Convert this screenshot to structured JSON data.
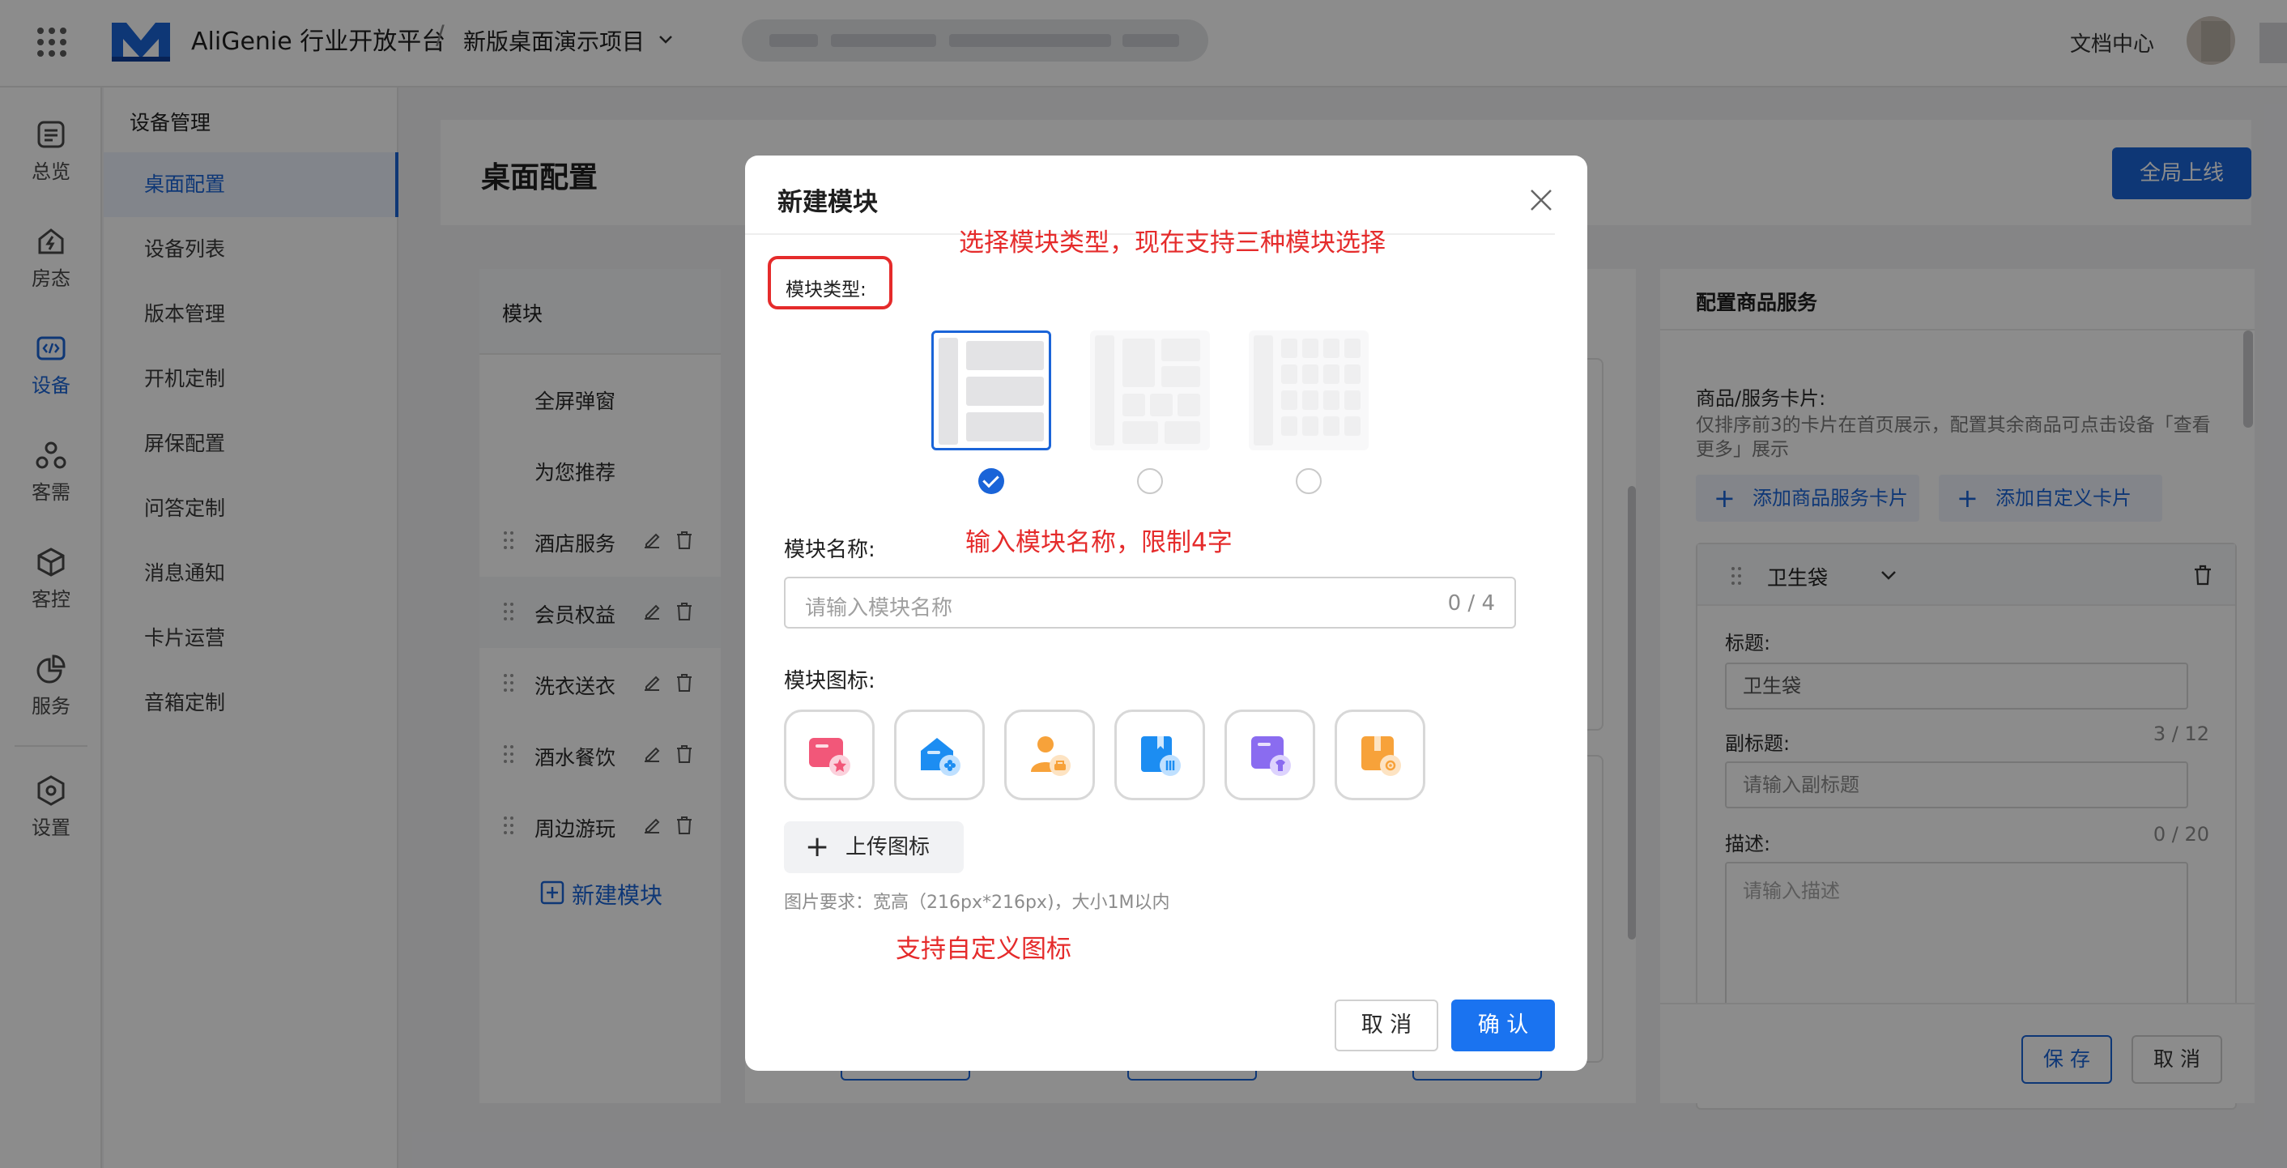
{
  "header": {
    "platform_title": "AliGenie 行业开放平台",
    "separator": "/",
    "project_name": "新版桌面演示项目",
    "doc_center": "文档中心"
  },
  "rail": {
    "items": [
      {
        "label": "总览",
        "icon": "overview-icon"
      },
      {
        "label": "房态",
        "icon": "room-status-icon"
      },
      {
        "label": "设备",
        "icon": "device-icon",
        "active": true
      },
      {
        "label": "客需",
        "icon": "guest-needs-icon"
      },
      {
        "label": "客控",
        "icon": "guest-control-icon"
      },
      {
        "label": "服务",
        "icon": "service-icon"
      },
      {
        "label": "设置",
        "icon": "settings-icon"
      }
    ]
  },
  "subnav": {
    "title": "设备管理",
    "items": [
      "桌面配置",
      "设备列表",
      "版本管理",
      "开机定制",
      "屏保配置",
      "问答定制",
      "消息通知",
      "卡片运营",
      "音箱定制"
    ],
    "active": "桌面配置"
  },
  "page": {
    "title": "桌面配置",
    "publish_button": "全局上线"
  },
  "module_panel": {
    "header": "模块",
    "fixed_items": [
      "全屏弹窗",
      "为您推荐"
    ],
    "items": [
      "酒店服务",
      "会员权益",
      "洗衣送衣",
      "酒水餐饮",
      "周边游玩"
    ],
    "new_module": "新建模块"
  },
  "right_panel": {
    "title": "配置商品服务",
    "cards_label": "商品/服务卡片:",
    "hint": "仅排序前3的卡片在首页展示，配置其余商品可点击设备「查看更多」展示",
    "add_product_card": "添加商品服务卡片",
    "add_custom_card": "添加自定义卡片",
    "card": {
      "name": "卫生袋",
      "title_label": "标题:",
      "title_value": "卫生袋",
      "subtitle_label": "副标题:",
      "subtitle_count": "3 / 12",
      "subtitle_placeholder": "请输入副标题",
      "desc_label": "描述:",
      "desc_count": "0 / 20",
      "desc_placeholder": "请输入描述"
    },
    "save_button": "保 存",
    "cancel_button": "取 消"
  },
  "dialog": {
    "title": "新建模块",
    "annotation_type": "选择模块类型，现在支持三种模块选择",
    "type_label": "模块类型:",
    "annotation_name": "输入模块名称，限制4字",
    "name_label": "模块名称:",
    "name_placeholder": "请输入模块名称",
    "name_count": "0 / 4",
    "icon_label": "模块图标:",
    "icons": [
      "pink-star-icon",
      "blue-game-icon",
      "orange-person-icon",
      "blue-book-icon",
      "purple-shirt-icon",
      "orange-box-icon"
    ],
    "upload_button": "上传图标",
    "image_requirement": "图片要求：宽高（216px*216px)，大小1M以内",
    "annotation_icon": "支持自定义图标",
    "cancel_button": "取 消",
    "confirm_button": "确 认"
  },
  "colors": {
    "primary": "#1a64d8",
    "annotation": "#e52b2b"
  }
}
